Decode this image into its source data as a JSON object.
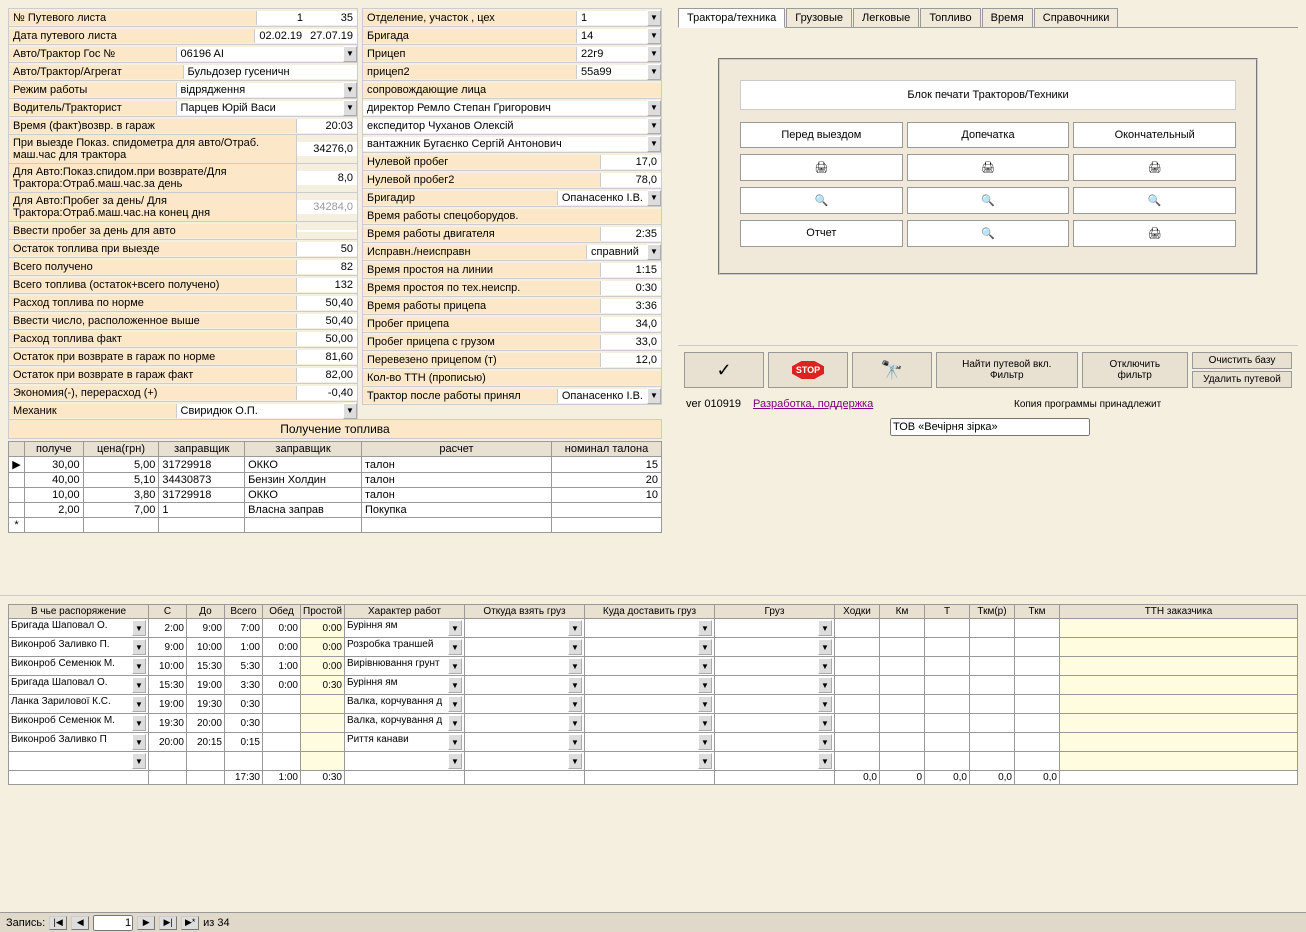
{
  "col1": {
    "row1": {
      "label": "№ Путевого листа",
      "v1": "1",
      "v2": "35"
    },
    "row2": {
      "label": "Дата путевого листа",
      "v1": "02.02.19",
      "v2": "27.07.19"
    },
    "row3": {
      "label": "Авто/Трактор Гос №",
      "v": "06196 AI"
    },
    "row4": {
      "label": "Авто/Трактор/Агрегат",
      "v": "Бульдозер гусеничн"
    },
    "row5": {
      "label": "Режим работы",
      "v": "відрядження"
    },
    "row6": {
      "label": "Водитель/Тракторист",
      "v": "Парцев Юрій Васи"
    },
    "row7": {
      "label": "Время (факт)возвр. в гараж",
      "v": "20:03"
    },
    "row8": {
      "label": "При выезде Показ. спидометра для авто/Отраб. маш.час для трактора",
      "v": "34276,0"
    },
    "row9": {
      "label": "Для Авто:Показ.спидом.при возврате/Для Трактора:Отраб.маш.час.за день",
      "v": "8,0"
    },
    "row10": {
      "label": "Для Авто:Пробег за день/ Для Трактора:Отраб.маш.час.на конец дня",
      "v": "34284,0"
    },
    "row11": {
      "label": "Ввести пробег за день для авто",
      "v": ""
    },
    "row12": {
      "label": "Остаток топлива при выезде",
      "v": "50"
    },
    "row13": {
      "label": "Всего получено",
      "v": "82"
    },
    "row14": {
      "label": "Всего топлива (остаток+всего получено)",
      "v": "132"
    },
    "row15": {
      "label": "Расход топлива по норме",
      "v": "50,40"
    },
    "row16": {
      "label": "Ввести число, расположенное выше",
      "v": "50,40"
    },
    "row17": {
      "label": "Расход топлива факт",
      "v": "50,00"
    },
    "row18": {
      "label": "Остаток при возврате в гараж по норме",
      "v": "81,60"
    },
    "row19": {
      "label": "Остаток при возврате в гараж  факт",
      "v": "82,00"
    },
    "row20": {
      "label": "Экономия(-), перерасход (+)",
      "v": "-0,40"
    },
    "row21": {
      "label": "Механик",
      "v": "Свиридюк О.П."
    }
  },
  "col2": {
    "r1": {
      "label": "Отделение, участок , цех",
      "v": "1"
    },
    "r2": {
      "label": "Бригада",
      "v": "14"
    },
    "r3": {
      "label": "Прицеп",
      "v": "22г9"
    },
    "r4": {
      "label": "прицеп2",
      "v": "55а99"
    },
    "r5": {
      "label": "сопровождающие лица"
    },
    "r6": {
      "v": "директор Ремло Степан Григорович"
    },
    "r7": {
      "v": "експедитор Чуханов Олексій"
    },
    "r8": {
      "v": "вантажник Бугаєнко Сергій Антонович"
    },
    "r9": {
      "label": "Нулевой пробег",
      "v": "17,0"
    },
    "r10": {
      "label": "Нулевой пробег2",
      "v": "78,0"
    },
    "r11": {
      "label": "Бригадир",
      "v": "Опанасенко І.В."
    },
    "r12": {
      "label": "Время работы спецоборудов."
    },
    "r13": {
      "label": "Время работы двигателя",
      "v": "2:35"
    },
    "r14": {
      "label": "Исправн./неисправн",
      "v": "справний"
    },
    "r15": {
      "label": "Время простоя на линии",
      "v": "1:15"
    },
    "r16": {
      "label": "Время простоя по тех.неиспр.",
      "v": "0:30"
    },
    "r17": {
      "label": "Время работы прицепа",
      "v": "3:36"
    },
    "r18": {
      "label": "Пробег прицепа",
      "v": "34,0"
    },
    "r19": {
      "label": "Пробег прицепа с грузом",
      "v": "33,0"
    },
    "r20": {
      "label": "Перевезено прицепом (т)",
      "v": "12,0"
    },
    "r21": {
      "label": "Кол-во ТТН (прописью)"
    },
    "r22": {
      "label": "Трактор после работы принял",
      "v": "Опанасенко І.В."
    }
  },
  "fuel": {
    "title": "Получение топлива",
    "hdr": {
      "c1": "получе",
      "c2": "цена(грн)",
      "c3": "заправщик",
      "c4": "заправщик",
      "c5": "расчет",
      "c6": "номинал талона"
    },
    "rows": [
      {
        "v1": "30,00",
        "v2": "5,00",
        "v3": "31729918",
        "v4": "ОККО",
        "v5": "талон",
        "v6": "15"
      },
      {
        "v1": "40,00",
        "v2": "5,10",
        "v3": "34430873",
        "v4": "Бензин Холдин",
        "v5": "талон",
        "v6": "20"
      },
      {
        "v1": "10,00",
        "v2": "3,80",
        "v3": "31729918",
        "v4": "ОККО",
        "v5": "талон",
        "v6": "10"
      },
      {
        "v1": "2,00",
        "v2": "7,00",
        "v3": "1",
        "v4": "Власна заправ",
        "v5": "Покупка",
        "v6": ""
      }
    ]
  },
  "tabs": [
    "Трактора/техника",
    "Грузовые",
    "Легковые",
    "Топливо",
    "Время",
    "Справочники"
  ],
  "print": {
    "title": "Блок печати Тракторов/Техники",
    "h1": "Перед выездом",
    "h2": "Допечатка",
    "h3": "Окончательный",
    "report": "Отчет"
  },
  "toolbar": {
    "find": "Найти путевой вкл. Фильтр",
    "disable": "Отключить фильтр",
    "clear": "Очистить базу",
    "del": "Удалить путевой"
  },
  "ver": {
    "v": "ver 010919",
    "link": "Разработка, поддержка",
    "copy": "Копия программы принадлежит",
    "owner": "ТОВ «Вечірня зірка»"
  },
  "work": {
    "hdr": [
      "В чье распоряжение",
      "С",
      "До",
      "Всего",
      "Обед",
      "Простой",
      "Характер работ",
      "Откуда взять груз",
      "Куда доставить груз",
      "Груз",
      "Ходки",
      "Км",
      "Т",
      "Ткм(р)",
      "Ткм",
      "ТТН заказчика"
    ],
    "rows": [
      {
        "disp": "Бригада Шаповал О.",
        "c": "2:00",
        "d": "9:00",
        "vs": "7:00",
        "ob": "0:00",
        "pr": "0:00",
        "w": "Буріння ям"
      },
      {
        "disp": "Виконроб Заливко П.",
        "c": "9:00",
        "d": "10:00",
        "vs": "1:00",
        "ob": "0:00",
        "pr": "0:00",
        "w": "Розробка траншей"
      },
      {
        "disp": "Виконроб Семенюк М.",
        "c": "10:00",
        "d": "15:30",
        "vs": "5:30",
        "ob": "1:00",
        "pr": "0:00",
        "w": "Вирівнювання грунт"
      },
      {
        "disp": "Бригада Шаповал О.",
        "c": "15:30",
        "d": "19:00",
        "vs": "3:30",
        "ob": "0:00",
        "pr": "0:30",
        "w": "Буріння ям"
      },
      {
        "disp": "Ланка Зарилової К.С.",
        "c": "19:00",
        "d": "19:30",
        "vs": "0:30",
        "ob": "",
        "pr": "",
        "w": "Валка, корчування д"
      },
      {
        "disp": "Виконроб Семенюк М.",
        "c": "19:30",
        "d": "20:00",
        "vs": "0:30",
        "ob": "",
        "pr": "",
        "w": "Валка, корчування д"
      },
      {
        "disp": "Виконроб Заливко П",
        "c": "20:00",
        "d": "20:15",
        "vs": "0:15",
        "ob": "",
        "pr": "",
        "w": "Риття канави"
      },
      {
        "disp": "",
        "c": "",
        "d": "",
        "vs": "",
        "ob": "",
        "pr": "",
        "w": ""
      }
    ],
    "totals": {
      "vs": "17:30",
      "ob": "1:00",
      "pr": "0:30",
      "hod": "0,0",
      "km": "0",
      "t": "0,0",
      "tkmr": "0,0",
      "tkm": "0,0"
    }
  },
  "status": {
    "label": "Запись:",
    "pos": "1",
    "of": "из  34"
  }
}
